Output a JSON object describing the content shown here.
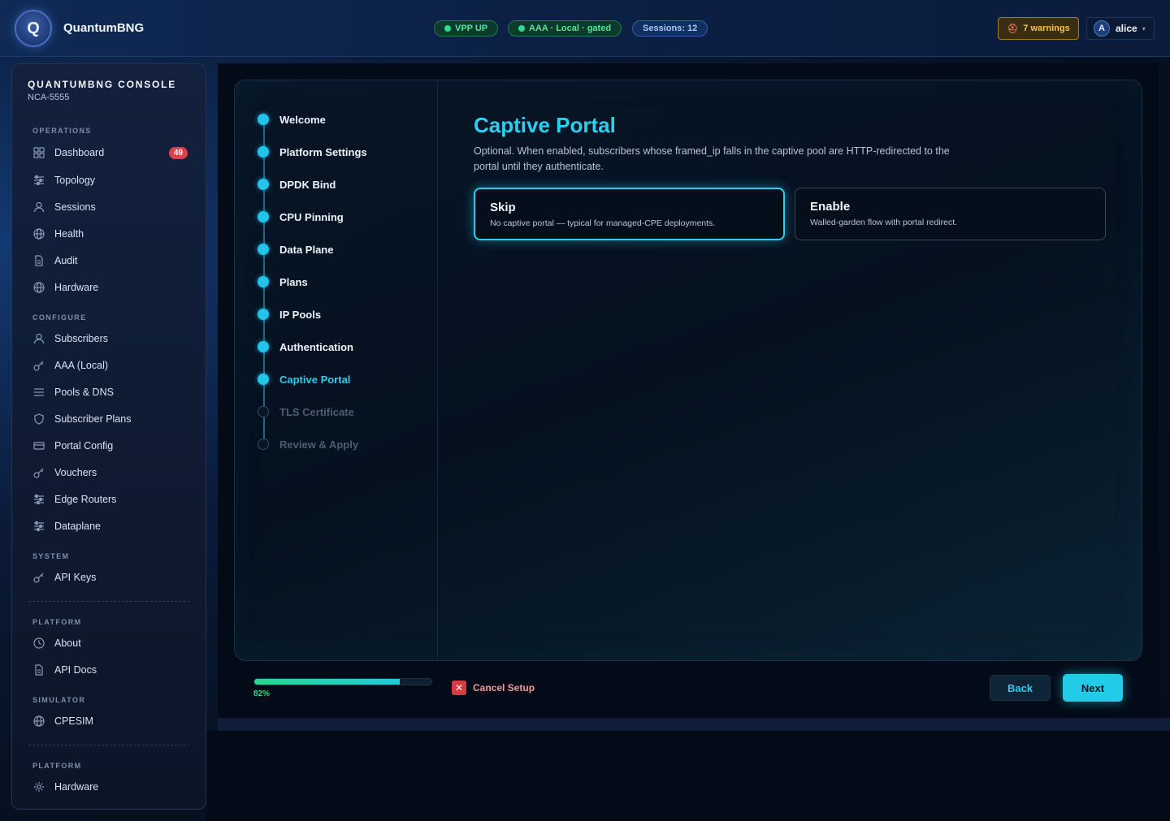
{
  "app": {
    "logo_letter": "Q",
    "brand": "QuantumBNG"
  },
  "status": {
    "vpp": "VPP UP",
    "aaa": "AAA · Local · gated",
    "sessions": "Sessions: 12",
    "warnings": "7 warnings",
    "user_initial": "A",
    "user_name": "alice"
  },
  "sidebar": {
    "title": "QUANTUMBNG CONSOLE",
    "subtitle": "NCA-5555",
    "sections": {
      "operations": "OPERATIONS",
      "configure": "CONFIGURE",
      "system": "SYSTEM",
      "platform": "PLATFORM",
      "simulator": "SIMULATOR",
      "platform2": "PLATFORM"
    },
    "items": {
      "dashboard": "Dashboard",
      "dashboard_badge": "49",
      "topology": "Topology",
      "sessions": "Sessions",
      "health": "Health",
      "audit": "Audit",
      "hardware": "Hardware",
      "subscribers": "Subscribers",
      "aaa_local": "AAA (Local)",
      "pools_dns": "Pools & DNS",
      "subscriber_plans": "Subscriber Plans",
      "portal_config": "Portal Config",
      "vouchers": "Vouchers",
      "edge_routers": "Edge Routers",
      "dataplane": "Dataplane",
      "api_keys": "API Keys",
      "about": "About",
      "api_docs": "API Docs",
      "cpesim": "CPESIM",
      "hardware2": "Hardware"
    }
  },
  "wizard": {
    "steps": [
      {
        "label": "Welcome",
        "state": "done"
      },
      {
        "label": "Platform Settings",
        "state": "done"
      },
      {
        "label": "DPDK Bind",
        "state": "done"
      },
      {
        "label": "CPU Pinning",
        "state": "done"
      },
      {
        "label": "Data Plane",
        "state": "done"
      },
      {
        "label": "Plans",
        "state": "done"
      },
      {
        "label": "IP Pools",
        "state": "done"
      },
      {
        "label": "Authentication",
        "state": "done"
      },
      {
        "label": "Captive Portal",
        "state": "active"
      },
      {
        "label": "TLS Certificate",
        "state": "pending"
      },
      {
        "label": "Review & Apply",
        "state": "pending"
      }
    ],
    "title": "Captive Portal",
    "description": "Optional. When enabled, subscribers whose framed_ip falls in the captive pool are HTTP-redirected to the portal until they authenticate.",
    "options": {
      "skip": {
        "title": "Skip",
        "desc": "No captive portal — typical for managed-CPE deployments.",
        "selected": true
      },
      "enable": {
        "title": "Enable",
        "desc": "Walled-garden flow with portal redirect.",
        "selected": false
      }
    },
    "progress_percent": 82,
    "progress_label": "82%",
    "cancel_label": "Cancel Setup",
    "back_label": "Back",
    "next_label": "Next"
  }
}
